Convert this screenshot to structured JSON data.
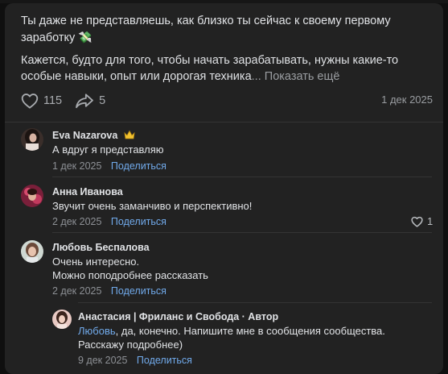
{
  "post": {
    "paragraph1": "Ты даже не представляешь, как близко ты сейчас к своему первому заработку",
    "money_emoji": "💸",
    "paragraph2": "Кажется, будто для того, чтобы начать зарабатывать, нужны какие-то особые навыки, опыт или дорогая техника",
    "ellipsis": "...",
    "show_more": "Показать ещё",
    "likes": "115",
    "shares": "5",
    "date": "1 дек 2025"
  },
  "comments": [
    {
      "author": "Eva Nazarova",
      "text": "А вдруг я представляю",
      "date": "1 дек 2025",
      "share_label": "Поделиться"
    },
    {
      "author": "Анна Иванова",
      "text": "Звучит очень заманчиво и перспективно!",
      "date": "2 дек 2025",
      "share_label": "Поделиться",
      "likes": "1"
    },
    {
      "author": "Любовь Беспалова",
      "text_line1": "Очень интересно.",
      "text_line2": "Можно поподробнее рассказать",
      "date": "2 дек 2025",
      "share_label": "Поделиться"
    }
  ],
  "reply": {
    "author": "Анастасия | Фриланс и Свобода · Автор",
    "mention": "Любовь",
    "text_line1": ", да, конечно. Напишите мне в сообщения сообщества.",
    "text_line2": "Расскажу подробнее)",
    "date": "9 дек 2025",
    "share_label": "Поделиться"
  },
  "colors": {
    "background": "#222222",
    "link": "#71aaeb",
    "secondary_text": "#8d9095"
  }
}
